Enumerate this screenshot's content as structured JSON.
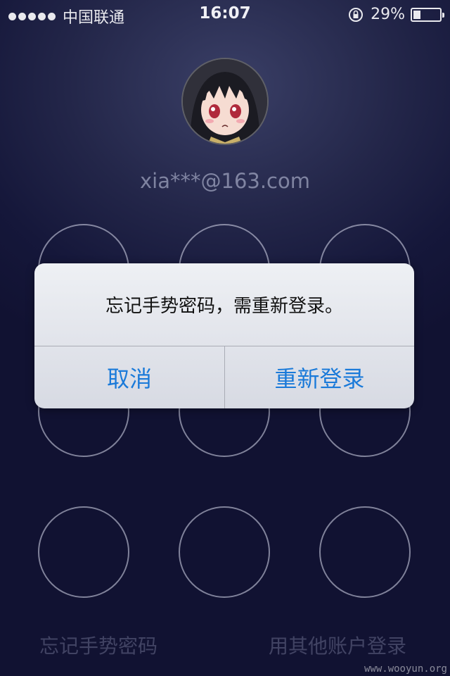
{
  "status_bar": {
    "carrier": "中国联通",
    "time": "16:07",
    "battery_percent_text": "29%",
    "battery_level": 0.29
  },
  "account": {
    "email": "xia***@163.com"
  },
  "gesture_grid": {
    "rows": 3,
    "cols": 3
  },
  "alert": {
    "message": "忘记手势密码，需重新登录。",
    "cancel_label": "取消",
    "relogin_label": "重新登录"
  },
  "footer": {
    "forgot_label": "忘记手势密码",
    "other_account_label": "用其他账户登录"
  },
  "watermark": "www.wooyun.org",
  "colors": {
    "accent": "#1a7ad9",
    "background": "#1c1f44"
  }
}
